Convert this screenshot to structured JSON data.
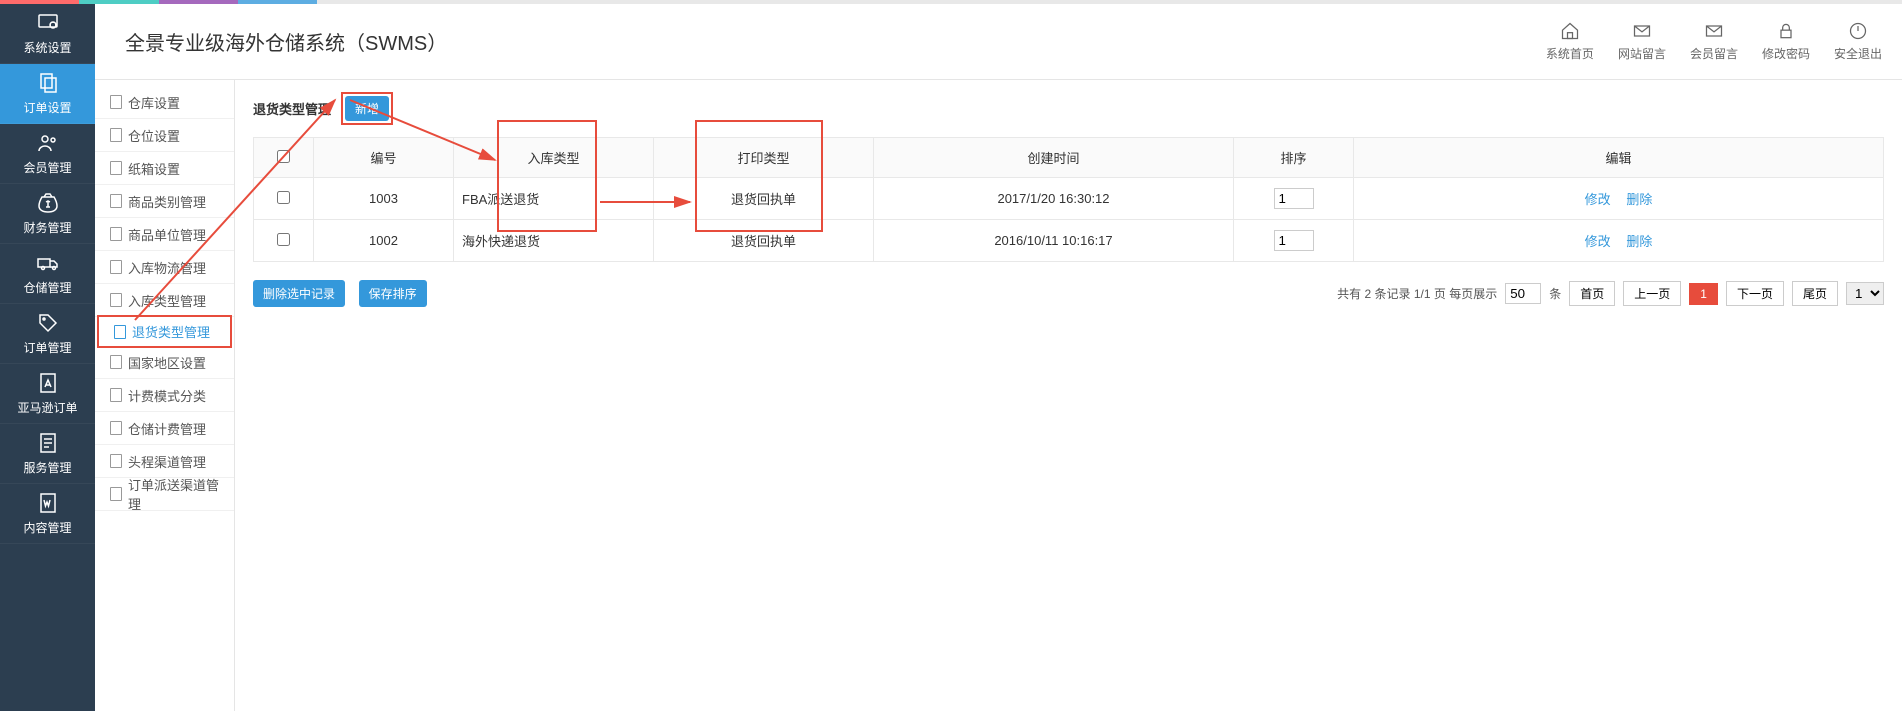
{
  "app_title": "全景专业级海外仓储系统（SWMS）",
  "sidebar": {
    "items": [
      {
        "label": "系统设置"
      },
      {
        "label": "订单设置"
      },
      {
        "label": "会员管理"
      },
      {
        "label": "财务管理"
      },
      {
        "label": "仓储管理"
      },
      {
        "label": "订单管理"
      },
      {
        "label": "亚马逊订单"
      },
      {
        "label": "服务管理"
      },
      {
        "label": "内容管理"
      }
    ]
  },
  "header_actions": {
    "home": "系统首页",
    "site_msg": "网站留言",
    "member_msg": "会员留言",
    "change_pwd": "修改密码",
    "logout": "安全退出"
  },
  "submenu": {
    "items": [
      {
        "label": "仓库设置"
      },
      {
        "label": "仓位设置"
      },
      {
        "label": "纸箱设置"
      },
      {
        "label": "商品类别管理"
      },
      {
        "label": "商品单位管理"
      },
      {
        "label": "入库物流管理"
      },
      {
        "label": "入库类型管理"
      },
      {
        "label": "退货类型管理"
      },
      {
        "label": "国家地区设置"
      },
      {
        "label": "计费模式分类"
      },
      {
        "label": "仓储计费管理"
      },
      {
        "label": "头程渠道管理"
      },
      {
        "label": "订单派送渠道管理"
      }
    ]
  },
  "page": {
    "title": "退货类型管理",
    "btn_new": "新增",
    "columns": {
      "id": "编号",
      "type": "入库类型",
      "print": "打印类型",
      "time": "创建时间",
      "sort": "排序",
      "edit": "编辑"
    },
    "rows": [
      {
        "id": "1003",
        "type": "FBA派送退货",
        "print": "退货回执单",
        "time": "2017/1/20 16:30:12",
        "sort": "1"
      },
      {
        "id": "1002",
        "type": "海外快递退货",
        "print": "退货回执单",
        "time": "2016/10/11 10:16:17",
        "sort": "1"
      }
    ],
    "action_edit": "修改",
    "action_delete": "删除",
    "btn_delete_selected": "删除选中记录",
    "btn_save_sort": "保存排序",
    "pagination": {
      "info_prefix": "共有 ",
      "total": "2",
      "info_mid": " 条记录   ",
      "page_info": "1/1 页",
      "per_page_label": " 每页展示 ",
      "per_page_value": "50",
      "unit": " 条 ",
      "first": "首页",
      "prev": "上一页",
      "current": "1",
      "next": "下一页",
      "last": "尾页",
      "select_value": "1"
    }
  }
}
